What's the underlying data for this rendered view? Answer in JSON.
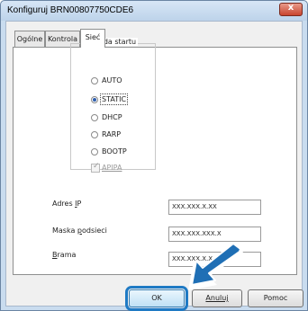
{
  "window": {
    "title": "Konfiguruj BRN00807750CDE6",
    "close_glyph": "x"
  },
  "tabs": [
    {
      "label": "Ogólne"
    },
    {
      "label": "Kontrola"
    },
    {
      "label": "Sieć",
      "active": true
    }
  ],
  "boot_method": {
    "title": "Metoda startu",
    "options": [
      {
        "label": "AUTO",
        "checked": false
      },
      {
        "label": "STATIC",
        "checked": true
      },
      {
        "label": "DHCP",
        "checked": false
      },
      {
        "label": "RARP",
        "checked": false
      },
      {
        "label": "BOOTP",
        "checked": false
      }
    ],
    "apipa": {
      "label": "APIPA",
      "checked": true,
      "disabled": true
    }
  },
  "fields": {
    "ip": {
      "label_prefix": "Adres ",
      "label_key": "I",
      "label_suffix": "P",
      "value": "XXX.XXX.X.XX"
    },
    "mask": {
      "label_prefix": "Maska ",
      "label_key": "p",
      "label_suffix": "odsieci",
      "value": "XXX.XXX.XXX.X"
    },
    "gateway": {
      "label_prefix": "",
      "label_key": "B",
      "label_suffix": "rama",
      "value": "XXX.XXX.X.X"
    }
  },
  "buttons": {
    "ok": "OK",
    "cancel": "Anuluj",
    "help": "Pomoc"
  },
  "colors": {
    "highlight": "#1f7ac4",
    "arrow": "#1f6fb5"
  },
  "icons": [
    "close-icon",
    "pointer-arrow-icon"
  ]
}
